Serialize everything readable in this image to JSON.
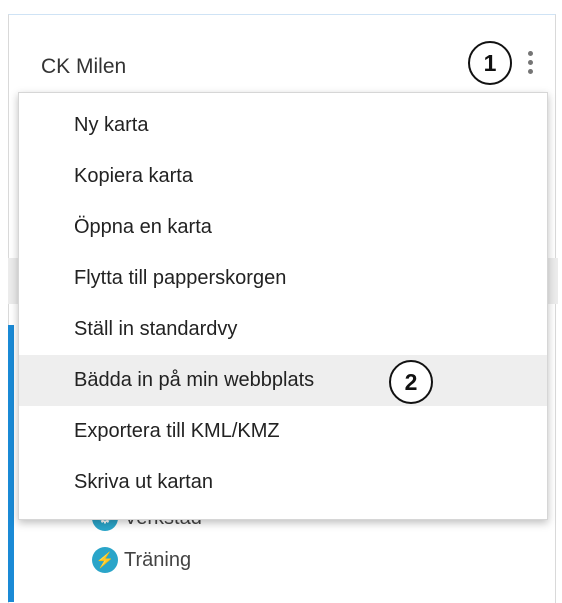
{
  "panel": {
    "title": "CK Milen"
  },
  "menu": {
    "items": [
      {
        "label": "Ny karta"
      },
      {
        "label": "Kopiera karta"
      },
      {
        "label": "Öppna en karta"
      },
      {
        "label": "Flytta till papperskorgen"
      },
      {
        "label": "Ställ in standardvy"
      },
      {
        "label": "Bädda in på min webbplats",
        "highlighted": true
      },
      {
        "label": "Exportera till KML/KMZ"
      },
      {
        "label": "Skriva ut kartan"
      }
    ]
  },
  "layers": {
    "items": [
      {
        "label": "Verkstad",
        "icon": "bicycle-icon"
      },
      {
        "label": "Träning",
        "icon": "runner-icon",
        "glyph": "★"
      }
    ]
  },
  "callouts": {
    "one": "1",
    "two": "2"
  },
  "colors": {
    "accent_bar": "#1a8ad6",
    "layer_icon": "#2aa5c9",
    "highlight": "#eeeeee"
  }
}
